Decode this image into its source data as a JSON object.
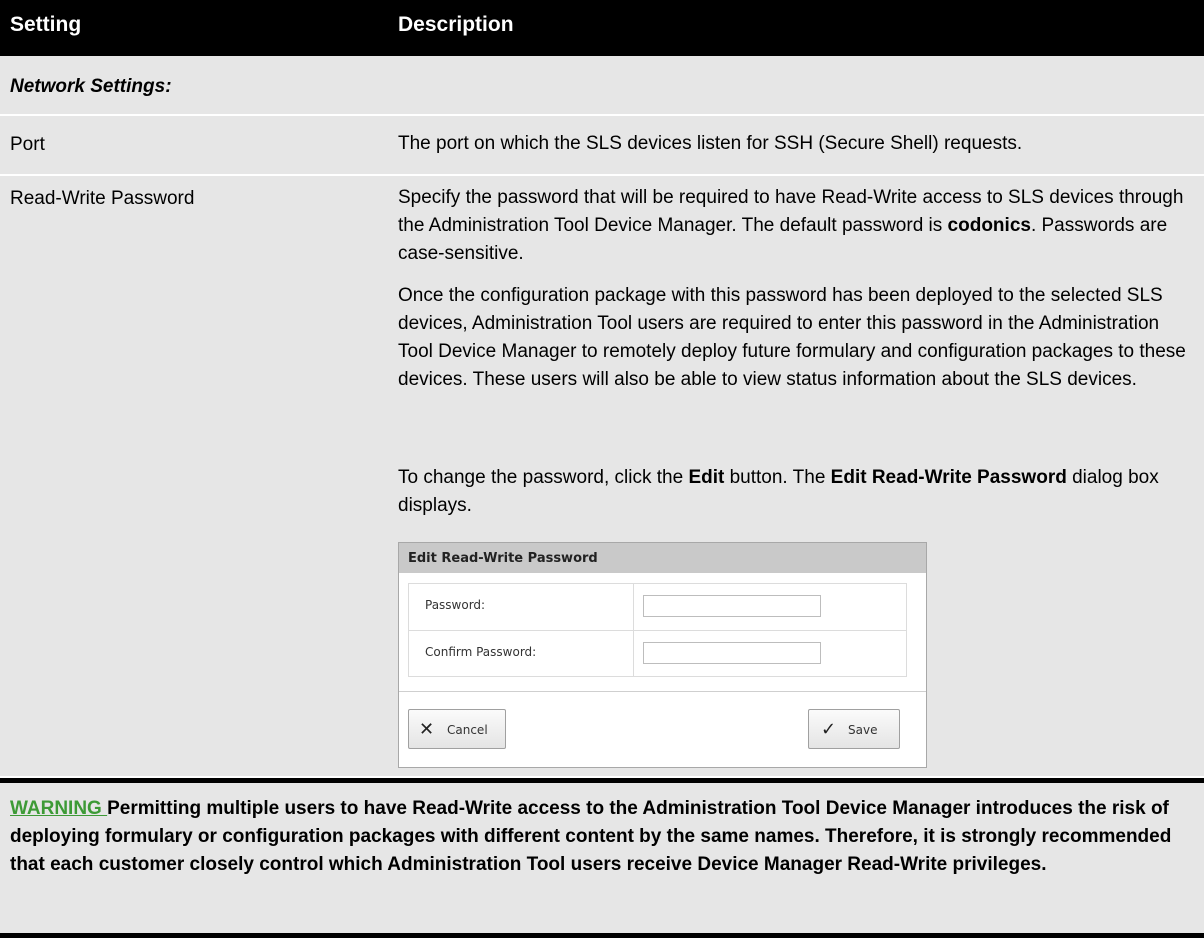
{
  "header": {
    "setting": "Setting",
    "description": "Description"
  },
  "section_title": "Network Settings:",
  "rows": {
    "port": {
      "setting": "Port",
      "description": "The port on which the SLS devices listen for SSH (Secure Shell) requests."
    },
    "rw_password": {
      "setting": "Read-Write Password",
      "p1": {
        "a": "Specify the password that will be required to have Read-Write access to SLS devices through the Administration Tool Device Manager. The default password is ",
        "bold": "codonics",
        "b": ". Passwords are case-sensitive."
      },
      "p2": "Once the configuration package with this password has been deployed to the selected SLS devices, Administration Tool users are required to enter this password in the Administration Tool Device Manager to remotely deploy future formulary and configuration packages to these devices. These users will also be able to view status information about the SLS devices.",
      "p3": {
        "a": "To change the password, click the ",
        "bold1": "Edit",
        "b": " button. The ",
        "bold2": "Edit Read-Write Password",
        "c": " dialog box displays."
      }
    }
  },
  "dialog": {
    "title": "Edit Read-Write Password",
    "password_label": "Password:",
    "password_value": "",
    "confirm_label": "Confirm Password:",
    "confirm_value": "",
    "cancel_icon": "close-icon",
    "cancel_label": "Cancel",
    "save_icon": "check-icon",
    "save_label": "Save"
  },
  "warning": {
    "tag": "WARNING ",
    "text": "Permitting multiple users to have Read-Write access to the Administration Tool Device Manager introduces the risk of deploying formulary or configuration packages with different content by the same names. Therefore, it is strongly recommended that each customer closely control which Administration Tool users receive Device Manager Read-Write privileges."
  },
  "colors": {
    "header_bg": "#000000",
    "row_bg": "#e6e6e6",
    "warning_link": "#3d9a36",
    "dialog_title_bg": "#c9c9c9"
  }
}
